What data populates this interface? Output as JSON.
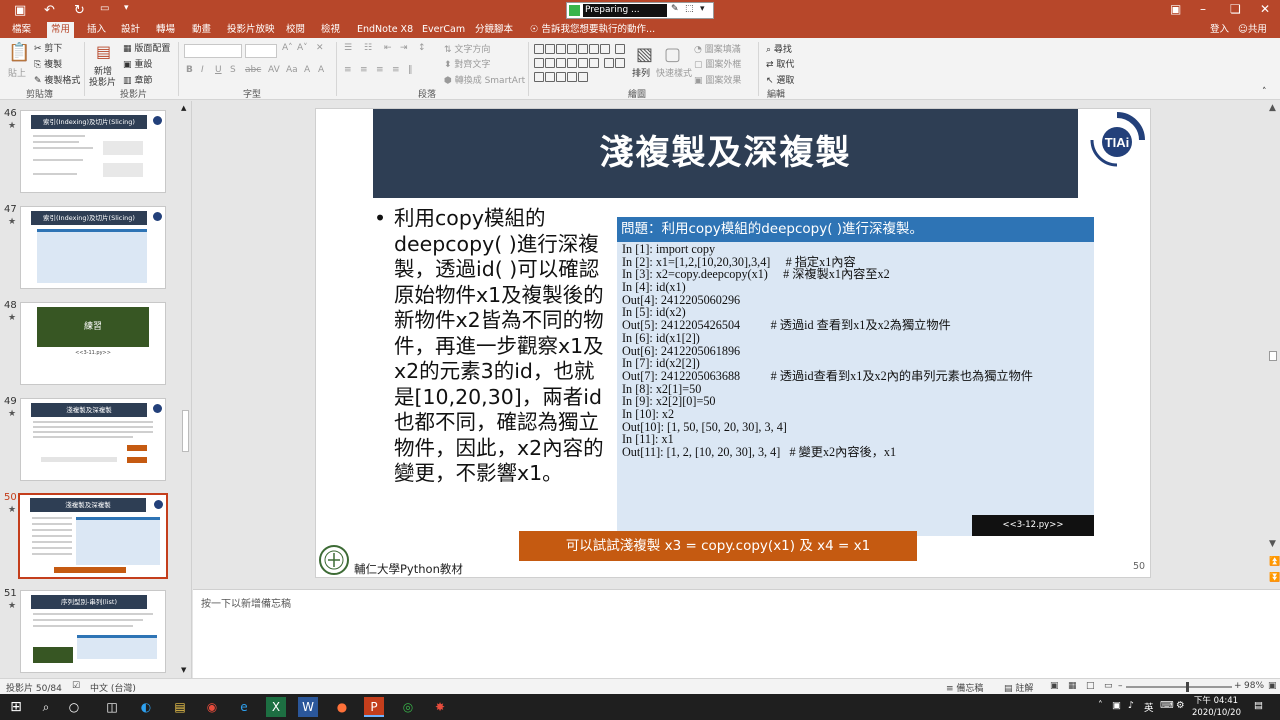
{
  "titlebar": {
    "search_text": "Preparing ...",
    "colors": {
      "accent": "#b7472a"
    }
  },
  "tabs": [
    "檔案",
    "常用",
    "插入",
    "設計",
    "轉場",
    "動畫",
    "投影片放映",
    "校閱",
    "檢視",
    "EndNote X8",
    "EverCam",
    "分鏡腳本",
    "告訴我您想要執行的動作..."
  ],
  "account": {
    "login": "登入",
    "share": "共用"
  },
  "ribbon": {
    "clipboard": {
      "paste": "貼上",
      "cut": "剪下",
      "copy": "複製",
      "format_painter": "複製格式",
      "label": "剪貼簿"
    },
    "slides": {
      "new_slide": "新增",
      "new_slide2": "投影片",
      "layout": "版面配置",
      "reset": "重設",
      "section": "章節",
      "label": "投影片"
    },
    "font": {
      "label": "字型"
    },
    "paragraph": {
      "text_direction": "文字方向",
      "align_text": "對齊文字",
      "smartart": "轉換成 SmartArt",
      "label": "段落"
    },
    "drawing": {
      "arrange": "排列",
      "quick_styles": "快速樣式",
      "fill": "圖案填滿",
      "outline": "圖案外框",
      "effects": "圖案效果",
      "label": "繪圖"
    },
    "editing": {
      "find": "尋找",
      "replace": "取代",
      "select": "選取",
      "label": "編輯"
    }
  },
  "thumbnails": [
    {
      "num": "46",
      "title": "索引(Indexing)及切片(Slicing)"
    },
    {
      "num": "47",
      "title": "索引(Indexing)及切片(Slicing)"
    },
    {
      "num": "48",
      "title": "練習",
      "foot": "<<3-11.py>>"
    },
    {
      "num": "49",
      "title": "淺複製及深複製"
    },
    {
      "num": "50",
      "title": "淺複製及深複製"
    },
    {
      "num": "51",
      "title": "序列型別-串列(list)"
    }
  ],
  "slide": {
    "title": "淺複製及深複製",
    "bullet": "利用copy模組的deepcopy( )進行深複製，透過id( )可以確認原始物件x1及複製後的新物件x2皆為不同的物件，再進一步觀察x1及x2的元素3的id，也就是[10,20,30]，兩者id也都不同，確認為獨立物件，因此，x2內容的變更，不影響x1。",
    "code_header": "問題：利用copy模組的deepcopy( )進行深複製。",
    "code_lines": [
      "In [1]: import copy",
      "In [2]: x1=[1,2,[10,20,30],3,4]     # 指定x1內容",
      "In [3]: x2=copy.deepcopy(x1)     # 深複製x1內容至x2",
      "In [4]: id(x1)",
      "Out[4]: 2412205060296",
      "In [5]: id(x2)",
      "Out[5]: 2412205426504          # 透過id 查看到x1及x2為獨立物件",
      "In [6]: id(x1[2])",
      "Out[6]: 2412205061896",
      "In [7]: id(x2[2])",
      "Out[7]: 2412205063688          # 透過id查看到x1及x2內的串列元素也為獨立物件",
      "In [8]: x2[1]=50",
      "In [9]: x2[2][0]=50",
      "In [10]: x2",
      "Out[10]: [1, 50, [50, 20, 30], 3, 4]",
      "In [11]: x1",
      "Out[11]: [1, 2, [10, 20, 30], 3, 4]   # 變更x2內容後，x1"
    ],
    "py_tag": "<<3-12.py>>",
    "hint": "可以試試淺複製 x3 = copy.copy(x1) 及 x4 = x1",
    "university": "輔仁大學Python教材",
    "page_number": "50",
    "logo_text": "TIAi"
  },
  "notes": {
    "placeholder": "按一下以新增備忘稿"
  },
  "status": {
    "slide_counter": "投影片 50/84",
    "language": "中文 (台灣)",
    "notes": "備忘稿",
    "comments": "註解",
    "zoom": "98%",
    "zoom_fraction": 0.98
  },
  "taskbar": {
    "time": "下午 04:41",
    "date": "2020/10/20",
    "ime": "英"
  }
}
